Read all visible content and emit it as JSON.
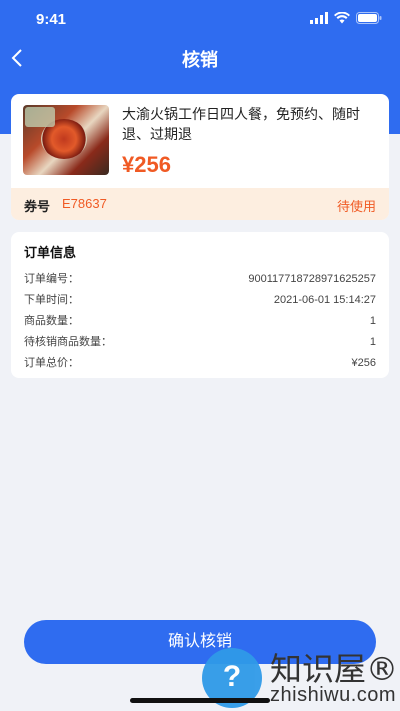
{
  "status_bar": {
    "time": "9:41"
  },
  "nav": {
    "title": "核销",
    "back_icon": "chevron-left-icon"
  },
  "product": {
    "name": "大渝火锅工作日四人餐，免预约、随时退、过期退",
    "price": "¥256"
  },
  "coupon": {
    "label": "券号",
    "code": "E78637",
    "status": "待使用"
  },
  "order": {
    "title": "订单信息",
    "rows": [
      {
        "label": "订单编号：",
        "value": "900117718728971625257"
      },
      {
        "label": "下单时间：",
        "value": "2021-06-01 15:14:27"
      },
      {
        "label": "商品数量：",
        "value": "1"
      },
      {
        "label": "待核销商品数量：",
        "value": "1"
      },
      {
        "label": "订单总价：",
        "value": "¥256"
      }
    ]
  },
  "confirm_button": {
    "label": "确认核销"
  },
  "watermark": {
    "brand": "知识屋®",
    "url": "zhishiwu.com"
  },
  "colors": {
    "primary": "#2f6cf0",
    "accent": "#f05a24",
    "coupon_bg": "#fdeee0",
    "page_bg": "#f0f2f7"
  }
}
